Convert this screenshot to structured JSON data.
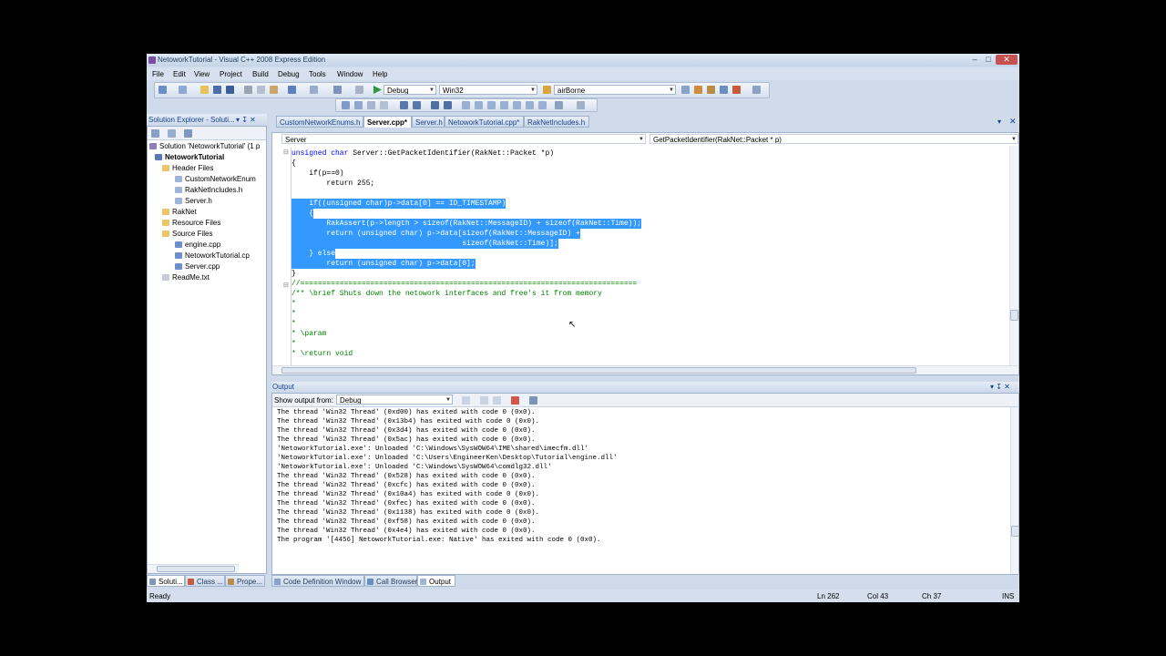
{
  "window": {
    "title": "NetoworkTutorial - Visual C++ 2008 Express Edition",
    "min_glyph": "–",
    "max_glyph": "□",
    "close_glyph": "✕"
  },
  "menu": [
    "File",
    "Edit",
    "View",
    "Project",
    "Build",
    "Debug",
    "Tools",
    "Window",
    "Help"
  ],
  "toolbar": {
    "config": "Debug",
    "platform": "Win32",
    "find": "airBorne"
  },
  "solution_explorer": {
    "header": "Solution Explorer - Soluti...",
    "pin_glyph": "▾ ↧ ✕",
    "items": [
      "Solution 'NetoworkTutorial' (1 p",
      "NetoworkTutorial",
      "Header Files",
      "CustomNetworkEnum",
      "RakNetIncludes.h",
      "Server.h",
      "RakNet",
      "Resource Files",
      "Source Files",
      "engine.cpp",
      "NetoworkTutorial.cp",
      "Server.cpp",
      "ReadMe.txt"
    ]
  },
  "editor": {
    "tabs": [
      "CustomNetworkEnums.h",
      "Server.cpp*",
      "Server.h",
      "NetoworkTutorial.cpp*",
      "RakNetIncludes.h"
    ],
    "scope": "Server",
    "member": "GetPacketIdentifier(RakNet::Packet * p)",
    "lines": [
      "unsigned char Server::GetPacketIdentifier(RakNet::Packet *p)",
      "{",
      "    if(p==0)",
      "        return 255;",
      "",
      "    if((unsigned char)p->data[0] == ID_TIMESTAMP)",
      "    {",
      "        RakAssert(p->length > sizeof(RakNet::MessageID) + sizeof(RakNet::Time));",
      "        return (unsigned char) p->data[sizeof(RakNet::MessageID) +",
      "                                       sizeof(RakNet::Time)];",
      "    } else",
      "        return (unsigned char) p->data[0];",
      "}",
      "//=============================================================================",
      "/** \\brief Shuts down the netowork interfaces and free's it from memory",
      "*",
      "*",
      "*",
      "* \\param",
      "*",
      "* \\return void"
    ]
  },
  "output": {
    "header": "Output",
    "show_from_label": "Show output from:",
    "source": "Debug",
    "lines": [
      "The thread 'Win32 Thread' (0xd00) has exited with code 0 (0x0).",
      "The thread 'Win32 Thread' (0x13b4) has exited with code 0 (0x0).",
      "The thread 'Win32 Thread' (0x3d4) has exited with code 0 (0x0).",
      "The thread 'Win32 Thread' (0x5ac) has exited with code 0 (0x0).",
      "'NetoworkTutorial.exe': Unloaded 'C:\\Windows\\SysWOW64\\IME\\shared\\imecfm.dll'",
      "'NetoworkTutorial.exe': Unloaded 'C:\\Users\\EngineerKen\\Desktop\\Tutorial\\engine.dll'",
      "'NetoworkTutorial.exe': Unloaded 'C:\\Windows\\SysWOW64\\comdlg32.dll'",
      "The thread 'Win32 Thread' (0x528) has exited with code 0 (0x0).",
      "The thread 'Win32 Thread' (0xcfc) has exited with code 0 (0x0).",
      "The thread 'Win32 Thread' (0x10a4) has exited with code 0 (0x0).",
      "The thread 'Win32 Thread' (0xfec) has exited with code 0 (0x0).",
      "The thread 'Win32 Thread' (0x1138) has exited with code 0 (0x0).",
      "The thread 'Win32 Thread' (0xf58) has exited with code 0 (0x0).",
      "The thread 'Win32 Thread' (0x4e4) has exited with code 0 (0x0).",
      "The program '[4456] NetoworkTutorial.exe: Native' has exited with code 0 (0x0)."
    ]
  },
  "bottom_tabs": {
    "left": [
      "Soluti...",
      "Class ...",
      "Prope..."
    ],
    "right": [
      "Code Definition Window",
      "Call Browser",
      "Output"
    ]
  },
  "status": {
    "text": "Ready",
    "ln": "Ln 262",
    "col": "Col 43",
    "ch": "Ch 37",
    "mode": "INS"
  }
}
